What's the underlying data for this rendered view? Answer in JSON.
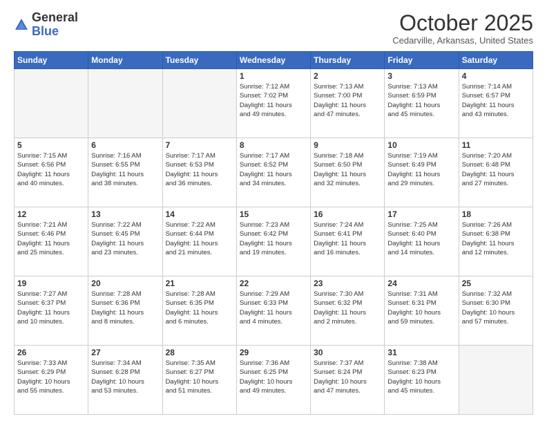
{
  "header": {
    "logo_general": "General",
    "logo_blue": "Blue",
    "month_title": "October 2025",
    "location": "Cedarville, Arkansas, United States"
  },
  "calendar": {
    "headers": [
      "Sunday",
      "Monday",
      "Tuesday",
      "Wednesday",
      "Thursday",
      "Friday",
      "Saturday"
    ],
    "weeks": [
      [
        {
          "day": "",
          "empty": true
        },
        {
          "day": "",
          "empty": true
        },
        {
          "day": "",
          "empty": true
        },
        {
          "day": "1",
          "info": "Sunrise: 7:12 AM\nSunset: 7:02 PM\nDaylight: 11 hours\nand 49 minutes."
        },
        {
          "day": "2",
          "info": "Sunrise: 7:13 AM\nSunset: 7:00 PM\nDaylight: 11 hours\nand 47 minutes."
        },
        {
          "day": "3",
          "info": "Sunrise: 7:13 AM\nSunset: 6:59 PM\nDaylight: 11 hours\nand 45 minutes."
        },
        {
          "day": "4",
          "info": "Sunrise: 7:14 AM\nSunset: 6:57 PM\nDaylight: 11 hours\nand 43 minutes."
        }
      ],
      [
        {
          "day": "5",
          "info": "Sunrise: 7:15 AM\nSunset: 6:56 PM\nDaylight: 11 hours\nand 40 minutes."
        },
        {
          "day": "6",
          "info": "Sunrise: 7:16 AM\nSunset: 6:55 PM\nDaylight: 11 hours\nand 38 minutes."
        },
        {
          "day": "7",
          "info": "Sunrise: 7:17 AM\nSunset: 6:53 PM\nDaylight: 11 hours\nand 36 minutes."
        },
        {
          "day": "8",
          "info": "Sunrise: 7:17 AM\nSunset: 6:52 PM\nDaylight: 11 hours\nand 34 minutes."
        },
        {
          "day": "9",
          "info": "Sunrise: 7:18 AM\nSunset: 6:50 PM\nDaylight: 11 hours\nand 32 minutes."
        },
        {
          "day": "10",
          "info": "Sunrise: 7:19 AM\nSunset: 6:49 PM\nDaylight: 11 hours\nand 29 minutes."
        },
        {
          "day": "11",
          "info": "Sunrise: 7:20 AM\nSunset: 6:48 PM\nDaylight: 11 hours\nand 27 minutes."
        }
      ],
      [
        {
          "day": "12",
          "info": "Sunrise: 7:21 AM\nSunset: 6:46 PM\nDaylight: 11 hours\nand 25 minutes."
        },
        {
          "day": "13",
          "info": "Sunrise: 7:22 AM\nSunset: 6:45 PM\nDaylight: 11 hours\nand 23 minutes."
        },
        {
          "day": "14",
          "info": "Sunrise: 7:22 AM\nSunset: 6:44 PM\nDaylight: 11 hours\nand 21 minutes."
        },
        {
          "day": "15",
          "info": "Sunrise: 7:23 AM\nSunset: 6:42 PM\nDaylight: 11 hours\nand 19 minutes."
        },
        {
          "day": "16",
          "info": "Sunrise: 7:24 AM\nSunset: 6:41 PM\nDaylight: 11 hours\nand 16 minutes."
        },
        {
          "day": "17",
          "info": "Sunrise: 7:25 AM\nSunset: 6:40 PM\nDaylight: 11 hours\nand 14 minutes."
        },
        {
          "day": "18",
          "info": "Sunrise: 7:26 AM\nSunset: 6:38 PM\nDaylight: 11 hours\nand 12 minutes."
        }
      ],
      [
        {
          "day": "19",
          "info": "Sunrise: 7:27 AM\nSunset: 6:37 PM\nDaylight: 11 hours\nand 10 minutes."
        },
        {
          "day": "20",
          "info": "Sunrise: 7:28 AM\nSunset: 6:36 PM\nDaylight: 11 hours\nand 8 minutes."
        },
        {
          "day": "21",
          "info": "Sunrise: 7:28 AM\nSunset: 6:35 PM\nDaylight: 11 hours\nand 6 minutes."
        },
        {
          "day": "22",
          "info": "Sunrise: 7:29 AM\nSunset: 6:33 PM\nDaylight: 11 hours\nand 4 minutes."
        },
        {
          "day": "23",
          "info": "Sunrise: 7:30 AM\nSunset: 6:32 PM\nDaylight: 11 hours\nand 2 minutes."
        },
        {
          "day": "24",
          "info": "Sunrise: 7:31 AM\nSunset: 6:31 PM\nDaylight: 10 hours\nand 59 minutes."
        },
        {
          "day": "25",
          "info": "Sunrise: 7:32 AM\nSunset: 6:30 PM\nDaylight: 10 hours\nand 57 minutes."
        }
      ],
      [
        {
          "day": "26",
          "info": "Sunrise: 7:33 AM\nSunset: 6:29 PM\nDaylight: 10 hours\nand 55 minutes."
        },
        {
          "day": "27",
          "info": "Sunrise: 7:34 AM\nSunset: 6:28 PM\nDaylight: 10 hours\nand 53 minutes."
        },
        {
          "day": "28",
          "info": "Sunrise: 7:35 AM\nSunset: 6:27 PM\nDaylight: 10 hours\nand 51 minutes."
        },
        {
          "day": "29",
          "info": "Sunrise: 7:36 AM\nSunset: 6:25 PM\nDaylight: 10 hours\nand 49 minutes."
        },
        {
          "day": "30",
          "info": "Sunrise: 7:37 AM\nSunset: 6:24 PM\nDaylight: 10 hours\nand 47 minutes."
        },
        {
          "day": "31",
          "info": "Sunrise: 7:38 AM\nSunset: 6:23 PM\nDaylight: 10 hours\nand 45 minutes."
        },
        {
          "day": "",
          "empty": true
        }
      ]
    ]
  }
}
